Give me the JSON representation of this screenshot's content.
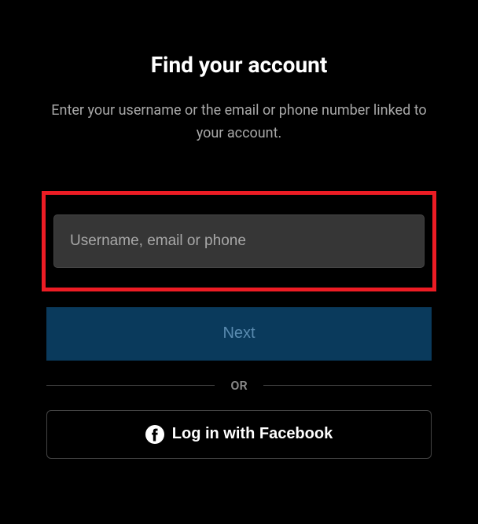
{
  "title": "Find your account",
  "subtitle": "Enter your username or the email or phone number linked to your account.",
  "input": {
    "placeholder": "Username, email or phone",
    "value": ""
  },
  "nextButton": "Next",
  "divider": "OR",
  "facebookButton": "Log in with Facebook"
}
